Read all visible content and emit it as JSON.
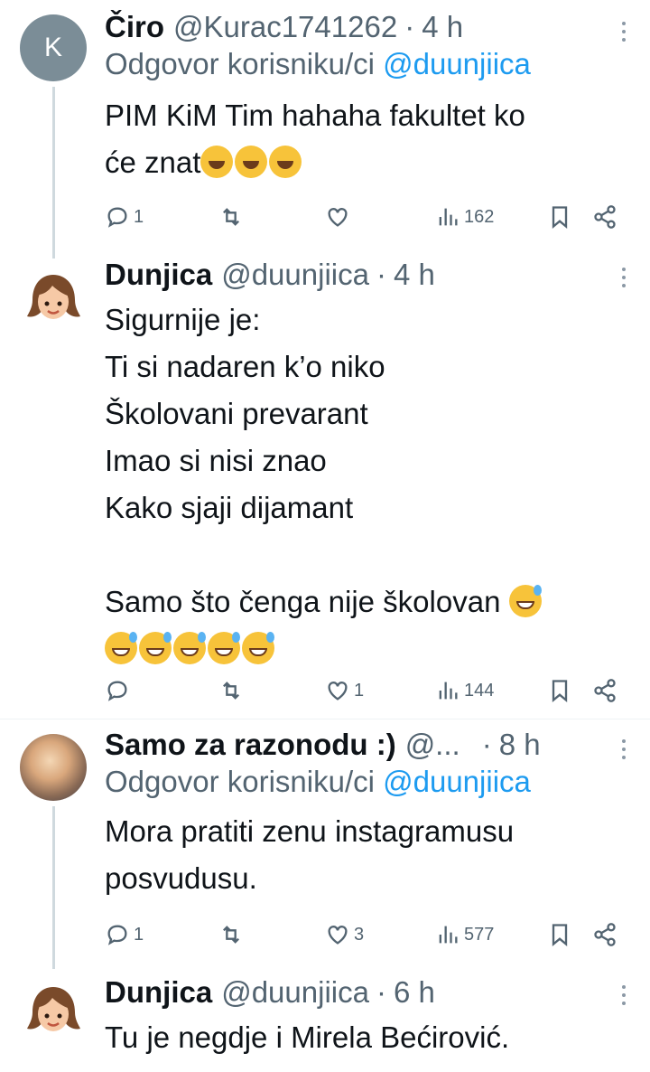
{
  "tweets": [
    {
      "avatar_letter": "K",
      "name": "Čiro",
      "handle": "@Kurac1741262",
      "dot": "·",
      "time": "4 h",
      "reply_prefix": "Odgovor korisniku/ci",
      "reply_mention": "@duunjiica",
      "text_lines": [
        "PIM KiM Tim hahaha fakultet ko",
        "će znat"
      ],
      "replies": "1",
      "retweets": "",
      "likes": "",
      "views": "162"
    },
    {
      "name": "Dunjica",
      "handle": "@duunjiica",
      "dot": "·",
      "time": "4 h",
      "text_lines": [
        "Sigurnije je:",
        "Ti si nadaren k’o niko",
        "Školovani prevarant",
        "Imao si nisi znao",
        "Kako sjaji dijamant",
        "",
        "Samo što čenga nije školovan"
      ],
      "replies": "",
      "retweets": "",
      "likes": "1",
      "views": "144"
    },
    {
      "name": "Samo za razonodu :)",
      "handle": "@...",
      "dot": "·",
      "time": "8 h",
      "reply_prefix": "Odgovor korisniku/ci",
      "reply_mention": "@duunjiica",
      "text_lines": [
        "Mora pratiti zenu instagramusu",
        "posvudusu."
      ],
      "replies": "1",
      "retweets": "",
      "likes": "3",
      "views": "577"
    },
    {
      "name": "Dunjica",
      "handle": "@duunjiica",
      "dot": "·",
      "time": "6 h",
      "text_lines": [
        "Tu je negdje i Mirela Bećirović."
      ]
    }
  ],
  "icons": {
    "reply": "reply-icon",
    "retweet": "retweet-icon",
    "like": "heart-icon",
    "views": "views-icon",
    "bookmark": "bookmark-icon",
    "share": "share-icon",
    "more": "more-icon"
  },
  "colors": {
    "link": "#1d9bf0",
    "secondary": "#536471",
    "text": "#0f1419",
    "thread_line": "#cfd9de"
  }
}
